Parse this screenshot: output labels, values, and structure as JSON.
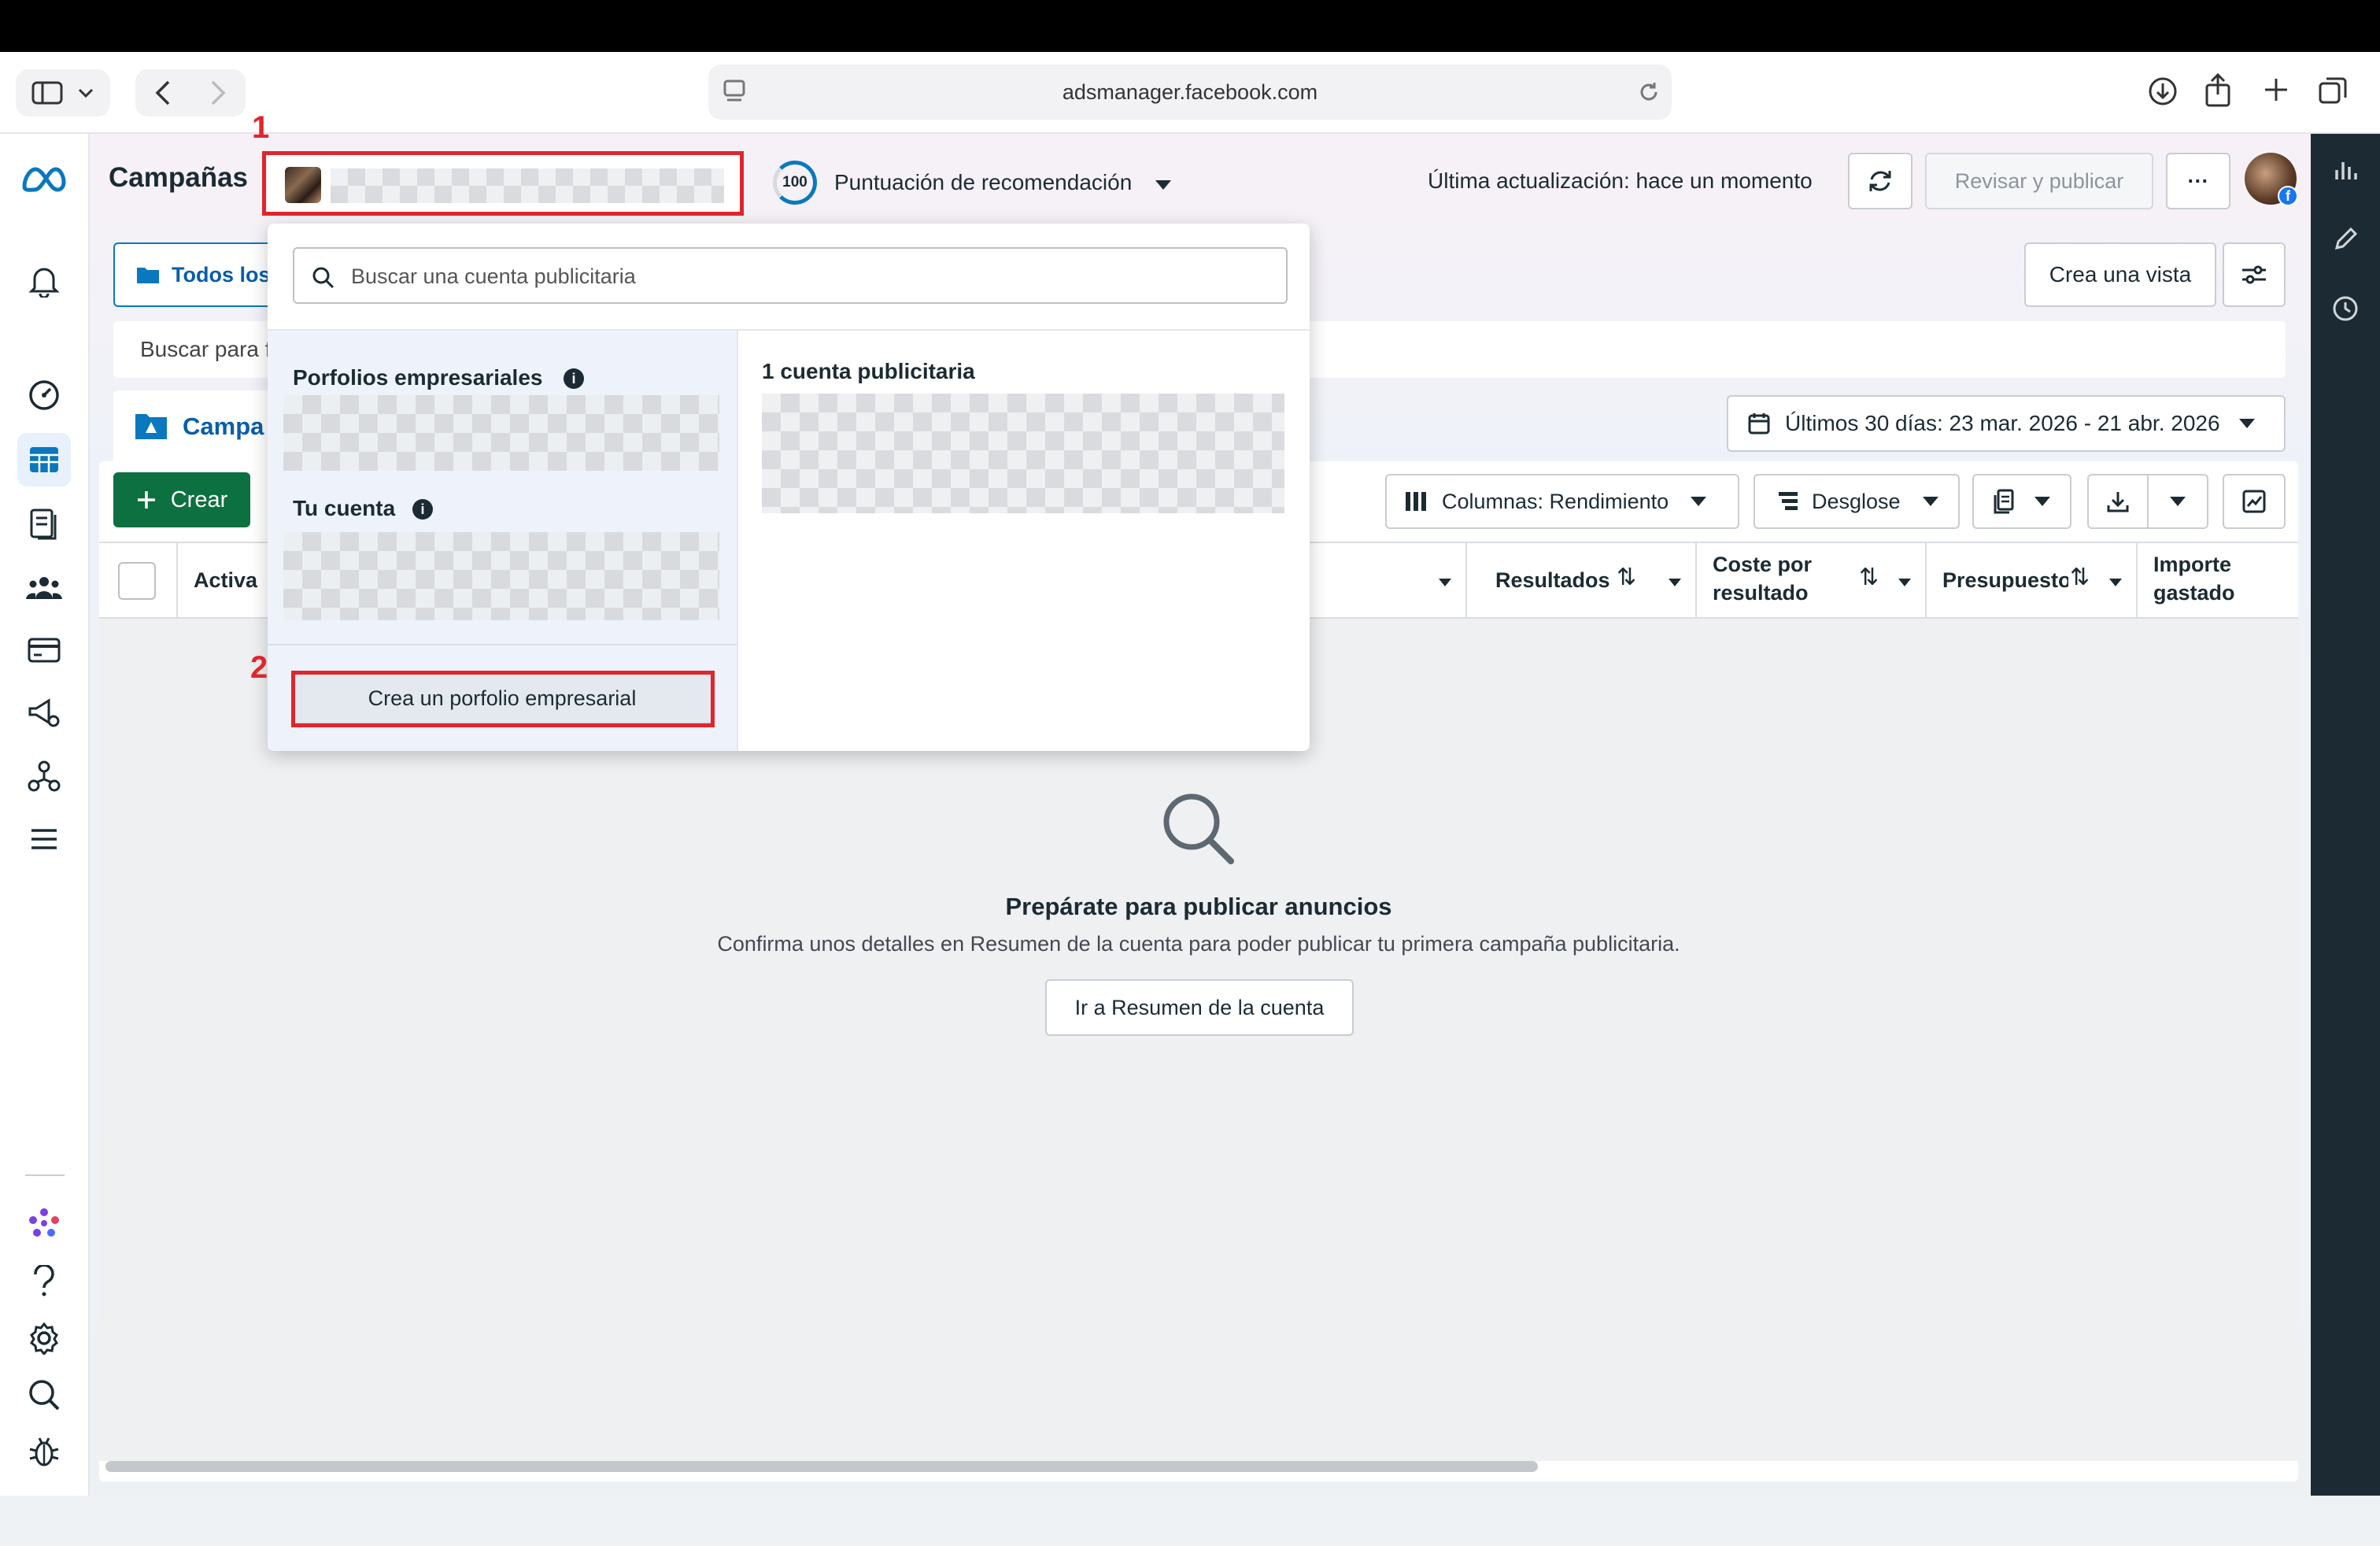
{
  "browser": {
    "url": "adsmanager.facebook.com"
  },
  "header": {
    "title": "Campañas",
    "recommendation_score": "100",
    "recommendation_label": "Puntuación de recomendación",
    "last_update": "Última actualización: hace un momento",
    "review_publish": "Revisar y publicar",
    "more": "···"
  },
  "toolbar": {
    "all_tab": "Todos los",
    "create_view": "Crea una vista",
    "search_placeholder": "Buscar para f",
    "campaigns_tab": "Campa",
    "date_range": "Últimos 30 días: 23 mar. 2026 - 21 abr. 2026",
    "create": "Crear",
    "columns": "Columnas: Rendimiento",
    "breakdown": "Desglose"
  },
  "table": {
    "headers": {
      "active": "Activa",
      "results": "Resultados",
      "cost_per_result_1": "Coste por",
      "cost_per_result_2": "resultado",
      "budget": "Presupuesto",
      "spent_1": "Importe",
      "spent_2": "gastado"
    }
  },
  "dropdown": {
    "search_placeholder": "Buscar una cuenta publicitaria",
    "portfolios_heading": "Porfolios empresariales",
    "your_account_heading": "Tu cuenta",
    "create_portfolio": "Crea un porfolio empresarial",
    "accounts_count": "1 cuenta publicitaria"
  },
  "annotations": {
    "step1": "1",
    "step2": "2"
  },
  "empty_state": {
    "title": "Prepárate para publicar anuncios",
    "subtitle": "Confirma unos detalles en Resumen de la cuenta para poder publicar tu primera campaña publicitaria.",
    "button": "Ir a Resumen de la cuenta"
  },
  "colors": {
    "accent": "#0a78be",
    "create_green": "#0d7040",
    "annotation_red": "#e0262d"
  }
}
